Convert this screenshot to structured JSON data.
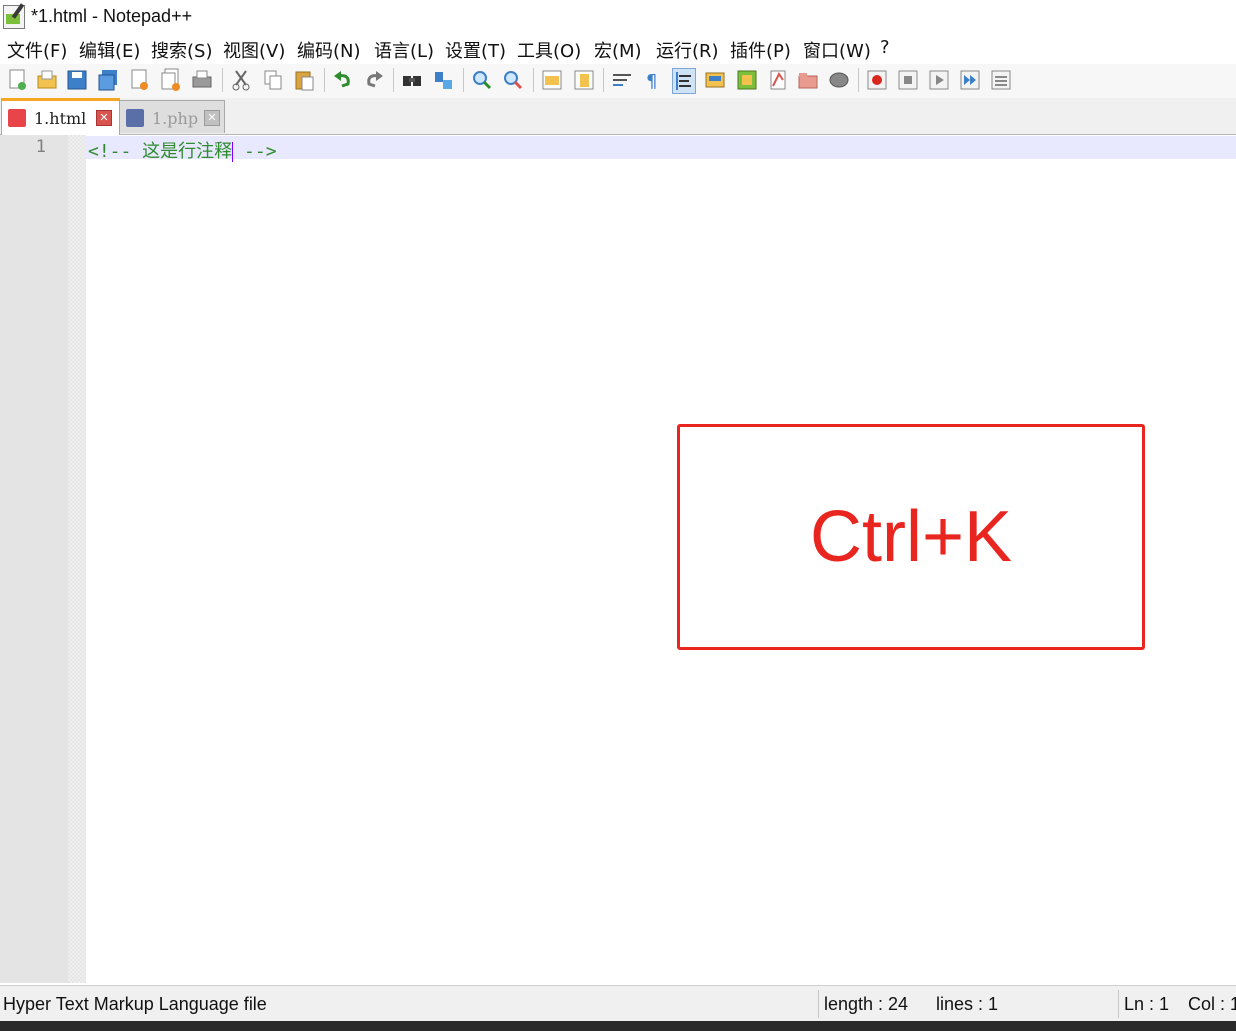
{
  "window": {
    "title": "*1.html - Notepad++"
  },
  "menu": [
    "文件(F)",
    "编辑(E)",
    "搜索(S)",
    "视图(V)",
    "编码(N)",
    "语言(L)",
    "设置(T)",
    "工具(O)",
    "宏(M)",
    "运行(R)",
    "插件(P)",
    "窗口(W)",
    "?"
  ],
  "toolbar": {
    "icons": [
      "new-file-icon",
      "open-file-icon",
      "save-icon",
      "save-all-icon",
      "close-icon",
      "close-all-icon",
      "print-icon",
      "cut-icon",
      "copy-icon",
      "paste-icon",
      "undo-icon",
      "redo-icon",
      "find-icon",
      "replace-icon",
      "zoom-in-icon",
      "zoom-out-icon",
      "sync-vertical-icon",
      "sync-horizontal-icon",
      "word-wrap-icon",
      "show-all-chars-icon",
      "indent-guide-icon",
      "doc-map-icon",
      "function-list-icon",
      "folder-as-workspace-icon",
      "monitor-icon",
      "record-macro-icon",
      "stop-macro-icon",
      "play-macro-icon",
      "run-macro-multiple-icon",
      "save-macro-icon"
    ]
  },
  "tabs": [
    {
      "label": "1.html",
      "active": true
    },
    {
      "label": "1.php",
      "active": false
    }
  ],
  "editor": {
    "line_number": "1",
    "code_before_caret": "<!-- 这是行注释",
    "code_after_caret": " -->"
  },
  "overlay": {
    "text": "Ctrl+K"
  },
  "status": {
    "file_type": "Hyper Text Markup Language file",
    "length": "length : 24",
    "lines": "lines : 1",
    "ln": "Ln : 1",
    "col": "Col : 1"
  },
  "colors": {
    "accent": "#e8261f",
    "comment_green": "#2e8b2e",
    "tab_active_top": "#f5a623"
  }
}
